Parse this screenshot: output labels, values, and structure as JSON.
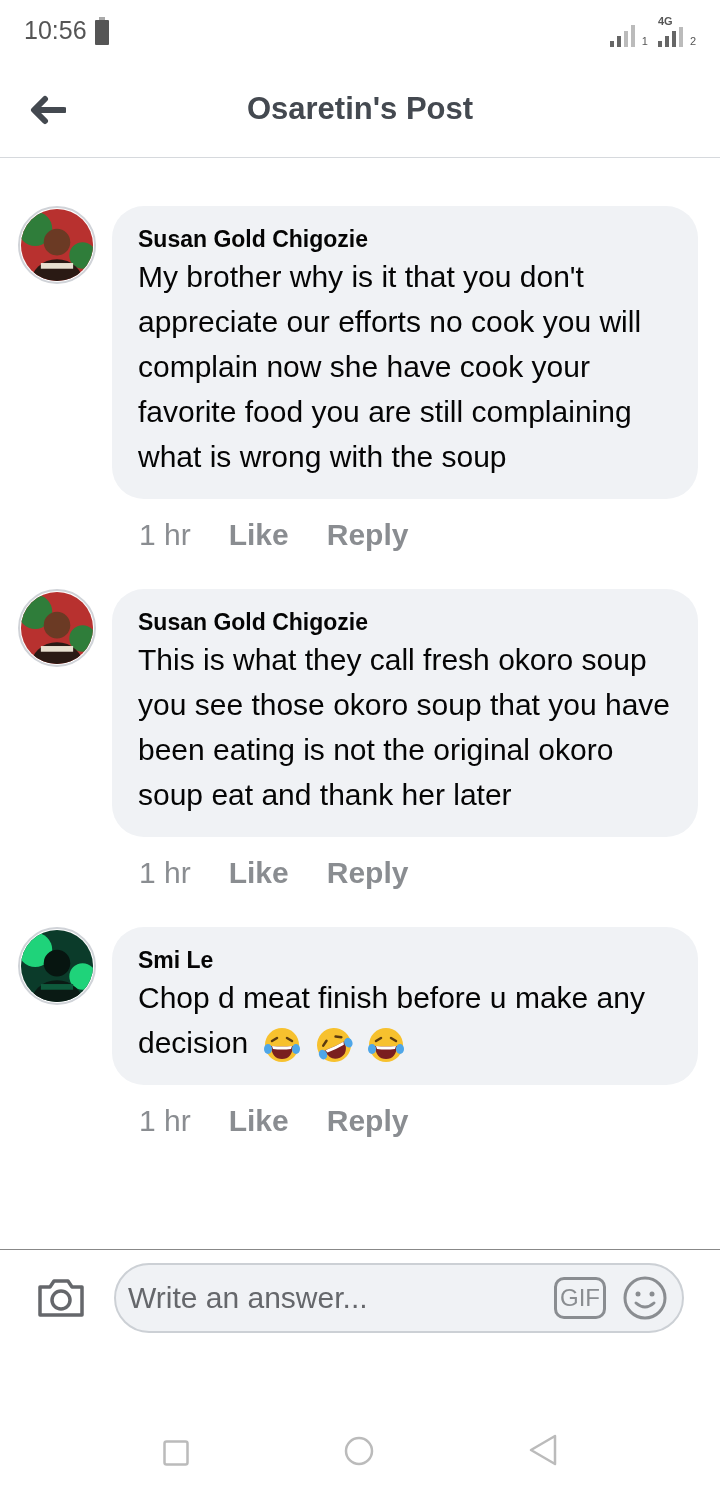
{
  "status_bar": {
    "time": "10:56",
    "network": "4G",
    "sim_1": "1",
    "sim_2": "2"
  },
  "header": {
    "title": "Osaretin's Post"
  },
  "comments": [
    {
      "author": "Susan Gold Chigozie",
      "text": "My brother why is it that you don't appreciate our efforts no cook you will complain now she have cook your favorite food you are still complaining what is wrong with the soup",
      "time": "1 hr",
      "like": "Like",
      "reply": "Reply"
    },
    {
      "author": "Susan Gold Chigozie",
      "text": "This is what they call fresh okoro soup you see those okoro soup that you have been eating is not the original okoro soup eat and thank her later",
      "time": "1 hr",
      "like": "Like",
      "reply": "Reply"
    },
    {
      "author": "Smi Le",
      "text": "Chop d meat finish before u make any decision",
      "emoji": [
        {
          "kind": "tears"
        },
        {
          "kind": "rolling"
        },
        {
          "kind": "tears"
        }
      ],
      "time": "1 hr",
      "like": "Like",
      "reply": "Reply"
    }
  ],
  "composer": {
    "placeholder": "Write an answer...",
    "gif": "GIF"
  }
}
